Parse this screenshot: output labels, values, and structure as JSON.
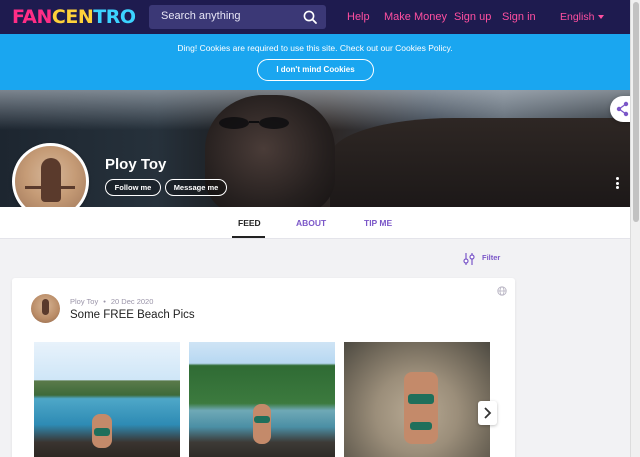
{
  "header": {
    "logo": {
      "part_a": "FAN",
      "part_b": "CEN",
      "part_c": "TRO"
    },
    "search_placeholder": "Search anything",
    "links": [
      "Help",
      "Make Money",
      "Sign up",
      "Sign in"
    ],
    "language": "English"
  },
  "cookie_banner": {
    "text": "Ding! Cookies are required to use this site. Check out our Cookies Policy.",
    "button": "I don't mind Cookies"
  },
  "profile": {
    "name": "Ploy Toy",
    "follow_label": "Follow me",
    "message_label": "Message me"
  },
  "tabs": [
    "FEED",
    "ABOUT",
    "TIP ME"
  ],
  "active_tab": "FEED",
  "filter_label": "Filter",
  "post": {
    "author": "Ploy Toy",
    "date": "20 Dec 2020",
    "title": "Some FREE Beach Pics"
  },
  "colors": {
    "nav_bg": "#1e1b4f",
    "nav_link": "#ff4fa0",
    "cookie_bg": "#1aa6f0",
    "accent_purple": "#7b57c8"
  },
  "icons": [
    "search-icon",
    "share-icon",
    "kebab-menu-icon",
    "filter-icon",
    "globe-icon",
    "chevron-right-icon"
  ]
}
